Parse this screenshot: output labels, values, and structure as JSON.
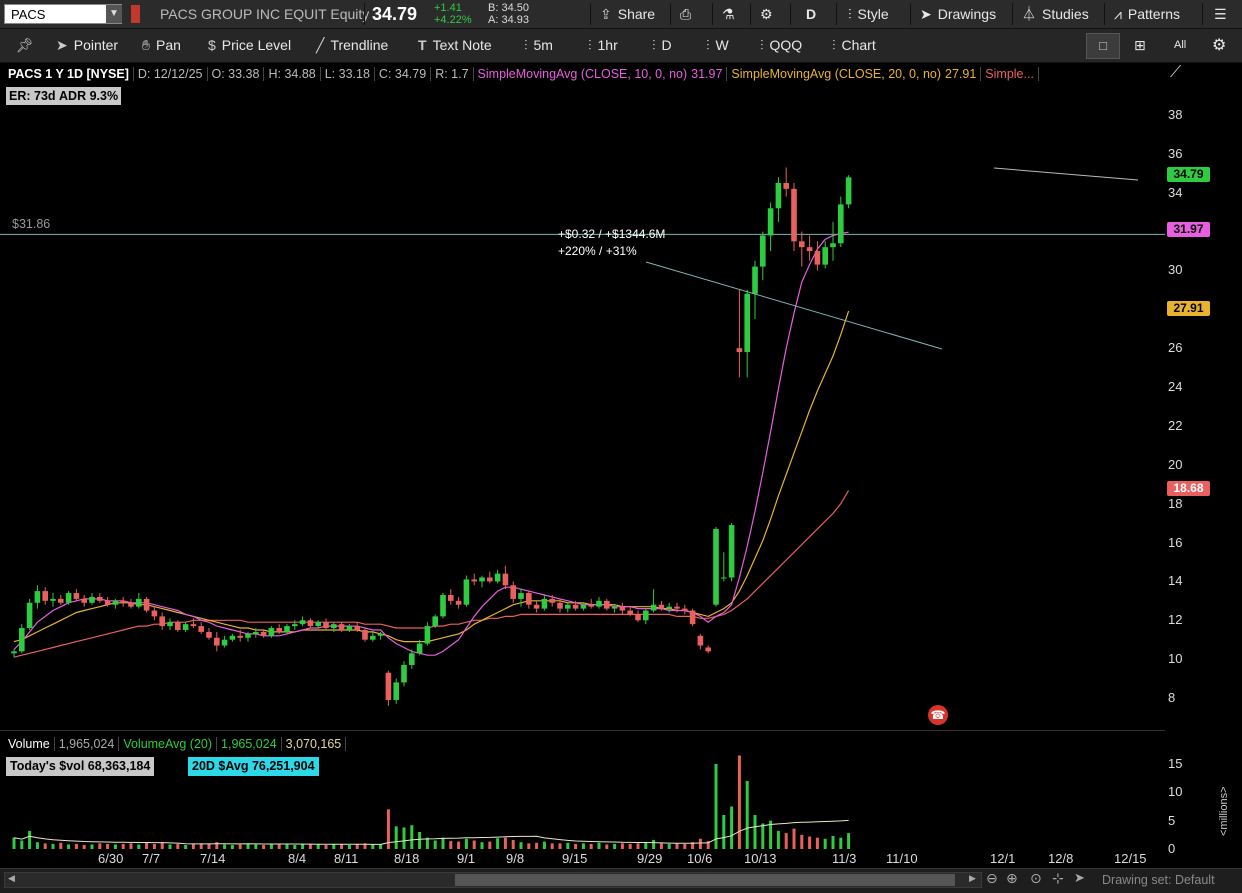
{
  "topbar": {
    "symbol": "PACS",
    "company": "PACS GROUP INC EQUIT Equity",
    "last": "34.79",
    "change": "+1.41",
    "change_pct": "+4.22%",
    "bid": "B: 34.50",
    "ask": "A: 34.93",
    "share": "Share",
    "period": "D",
    "style": "Style",
    "drawings": "Drawings",
    "studies": "Studies",
    "patterns": "Patterns"
  },
  "toolbar": {
    "pointer": "Pointer",
    "pan": "Pan",
    "price_level": "Price Level",
    "trendline": "Trendline",
    "text_note": "Text Note",
    "t5m": "5m",
    "t1hr": "1hr",
    "tD": "D",
    "tW": "W",
    "qqq": "QQQ",
    "chart": "Chart",
    "all": "All"
  },
  "info": {
    "title": "PACS 1 Y 1D [NYSE]",
    "date": "D: 12/12/25",
    "open": "O: 33.38",
    "high": "H: 34.88",
    "low": "L: 33.18",
    "close": "C: 34.79",
    "range": "R: 1.7",
    "sma10_label": "SimpleMovingAvg (CLOSE, 10, 0, no)",
    "sma10_val": "31.97",
    "sma20_label": "SimpleMovingAvg (CLOSE, 20, 0, no)",
    "sma20_val": "27.91",
    "sma_more": "Simple..."
  },
  "badges": {
    "er": "ER: 73d",
    "adr": "ADR 9.3%"
  },
  "level_line_label": "$31.86",
  "annotation": {
    "line1": "+$0.32 / +$1344.6M",
    "line2": "+220% / +31%"
  },
  "price_tags": {
    "last": "34.79",
    "sma10": "31.97",
    "sma20": "27.91",
    "sma50": "18.68"
  },
  "price_axis": [
    "38",
    "36",
    "34",
    "32",
    "30",
    "28",
    "26",
    "24",
    "22",
    "20",
    "18",
    "16",
    "14",
    "12",
    "10",
    "8"
  ],
  "volume": {
    "label": "Volume",
    "value": "1,965,024",
    "avg_label": "VolumeAvg (20)",
    "avg_value": "1,965,024",
    "other": "3,070,165",
    "todays": "Today's $vol 68,363,184",
    "avg20d": "20D $Avg 76,251,904",
    "axis": [
      "15",
      "10",
      "5",
      "0"
    ],
    "unit": "<millions>"
  },
  "x_axis": [
    "6/30",
    "7/7",
    "7/14",
    "8/4",
    "8/11",
    "8/18",
    "9/1",
    "9/8",
    "9/15",
    "9/29",
    "10/6",
    "10/13",
    "11/3",
    "11/10",
    "12/1",
    "12/8",
    "12/15"
  ],
  "bottom": {
    "drawing_set": "Drawing set: Default"
  },
  "colors": {
    "up": "#2ecc40",
    "down": "#e8615f",
    "sma10": "#e85ee0",
    "sma20": "#e8b430",
    "sma50": "#e8615f",
    "level": "#7fb5b5"
  },
  "chart_data": {
    "type": "candlestick",
    "candles": [
      [
        10.3,
        10.5,
        10.1,
        10.4
      ],
      [
        10.4,
        11.8,
        10.3,
        11.6
      ],
      [
        11.6,
        13.1,
        11.5,
        12.9
      ],
      [
        12.9,
        13.8,
        12.6,
        13.5
      ],
      [
        13.5,
        13.7,
        12.8,
        13.0
      ],
      [
        13.0,
        13.4,
        12.7,
        13.1
      ],
      [
        13.1,
        13.3,
        12.8,
        12.9
      ],
      [
        12.9,
        13.5,
        12.8,
        13.4
      ],
      [
        13.4,
        13.6,
        13.0,
        13.1
      ],
      [
        13.1,
        13.3,
        12.7,
        12.9
      ],
      [
        12.9,
        13.4,
        12.8,
        13.2
      ],
      [
        13.2,
        13.4,
        12.9,
        13.0
      ],
      [
        13.0,
        13.2,
        12.7,
        12.8
      ],
      [
        12.8,
        13.1,
        12.6,
        13.0
      ],
      [
        13.0,
        13.2,
        12.7,
        12.9
      ],
      [
        12.9,
        13.1,
        12.6,
        12.7
      ],
      [
        12.7,
        13.4,
        12.6,
        13.1
      ],
      [
        13.1,
        13.2,
        12.4,
        12.5
      ],
      [
        12.5,
        12.7,
        12.0,
        12.2
      ],
      [
        12.2,
        12.4,
        11.5,
        11.7
      ],
      [
        11.7,
        12.1,
        11.5,
        11.9
      ],
      [
        11.9,
        12.0,
        11.4,
        11.5
      ],
      [
        11.5,
        11.9,
        11.4,
        11.8
      ],
      [
        11.8,
        12.1,
        11.6,
        11.7
      ],
      [
        11.7,
        11.9,
        11.3,
        11.4
      ],
      [
        11.4,
        11.6,
        11.0,
        11.1
      ],
      [
        11.1,
        11.4,
        10.4,
        10.7
      ],
      [
        10.7,
        11.2,
        10.6,
        11.0
      ],
      [
        11.0,
        11.3,
        10.9,
        11.2
      ],
      [
        11.2,
        11.5,
        10.9,
        11.1
      ],
      [
        11.1,
        11.4,
        10.9,
        11.3
      ],
      [
        11.3,
        11.6,
        11.1,
        11.4
      ],
      [
        11.4,
        11.5,
        11.1,
        11.2
      ],
      [
        11.2,
        11.7,
        11.1,
        11.6
      ],
      [
        11.6,
        11.8,
        11.3,
        11.4
      ],
      [
        11.4,
        11.8,
        11.3,
        11.7
      ],
      [
        11.7,
        12.0,
        11.5,
        11.8
      ],
      [
        11.8,
        12.2,
        11.7,
        12.0
      ],
      [
        12.0,
        12.1,
        11.6,
        11.7
      ],
      [
        11.7,
        12.0,
        11.6,
        11.9
      ],
      [
        11.9,
        12.1,
        11.5,
        11.6
      ],
      [
        11.6,
        11.9,
        11.4,
        11.8
      ],
      [
        11.8,
        11.9,
        11.4,
        11.5
      ],
      [
        11.5,
        11.8,
        11.4,
        11.7
      ],
      [
        11.7,
        11.9,
        11.4,
        11.5
      ],
      [
        11.5,
        11.6,
        10.9,
        11.0
      ],
      [
        11.0,
        11.4,
        10.9,
        11.2
      ],
      [
        11.2,
        11.4,
        11.0,
        11.3
      ],
      [
        9.3,
        9.4,
        7.6,
        7.9
      ],
      [
        7.9,
        9.0,
        7.7,
        8.8
      ],
      [
        8.8,
        9.9,
        8.6,
        9.7
      ],
      [
        9.7,
        10.5,
        9.5,
        10.3
      ],
      [
        10.3,
        11.0,
        10.2,
        10.8
      ],
      [
        10.8,
        11.9,
        10.7,
        11.7
      ],
      [
        11.7,
        12.3,
        11.6,
        12.2
      ],
      [
        12.2,
        13.4,
        12.1,
        13.3
      ],
      [
        13.3,
        13.6,
        12.8,
        13.0
      ],
      [
        13.0,
        13.2,
        12.6,
        12.8
      ],
      [
        12.8,
        14.3,
        12.7,
        14.1
      ],
      [
        14.1,
        14.4,
        13.8,
        14.0
      ],
      [
        14.0,
        14.3,
        13.7,
        14.2
      ],
      [
        14.2,
        14.5,
        13.9,
        14.0
      ],
      [
        14.0,
        14.6,
        13.9,
        14.4
      ],
      [
        14.4,
        14.8,
        13.6,
        13.8
      ],
      [
        13.8,
        14.0,
        12.9,
        13.1
      ],
      [
        13.1,
        13.6,
        12.7,
        13.4
      ],
      [
        13.4,
        13.5,
        12.6,
        12.8
      ],
      [
        12.8,
        13.0,
        12.4,
        12.6
      ],
      [
        12.6,
        13.3,
        12.5,
        13.1
      ],
      [
        13.1,
        13.3,
        12.7,
        12.9
      ],
      [
        12.9,
        13.1,
        12.4,
        12.6
      ],
      [
        12.6,
        12.9,
        12.4,
        12.8
      ],
      [
        12.8,
        13.0,
        12.5,
        12.6
      ],
      [
        12.6,
        12.9,
        12.5,
        12.8
      ],
      [
        12.8,
        13.1,
        12.6,
        12.7
      ],
      [
        12.7,
        13.2,
        12.6,
        13.0
      ],
      [
        13.0,
        13.1,
        12.5,
        12.6
      ],
      [
        12.6,
        12.8,
        12.4,
        12.7
      ],
      [
        12.7,
        12.9,
        12.3,
        12.5
      ],
      [
        12.5,
        12.7,
        12.2,
        12.3
      ],
      [
        12.3,
        12.5,
        11.9,
        12.0
      ],
      [
        12.0,
        12.6,
        11.8,
        12.5
      ],
      [
        12.5,
        13.6,
        12.4,
        12.8
      ],
      [
        12.8,
        13.0,
        12.5,
        12.6
      ],
      [
        12.6,
        12.9,
        12.4,
        12.7
      ],
      [
        12.7,
        12.9,
        12.4,
        12.6
      ],
      [
        12.6,
        12.8,
        12.3,
        12.5
      ],
      [
        12.5,
        12.6,
        11.7,
        11.8
      ],
      [
        11.2,
        11.3,
        10.5,
        10.7
      ],
      [
        10.6,
        10.7,
        10.3,
        10.4
      ],
      [
        12.8,
        16.8,
        12.7,
        16.7
      ],
      [
        14.2,
        15.5,
        14.0,
        14.2
      ],
      [
        14.2,
        17.0,
        14.0,
        16.9
      ],
      [
        26.0,
        29.0,
        24.5,
        25.8
      ],
      [
        25.8,
        29.0,
        24.5,
        28.8
      ],
      [
        28.8,
        30.5,
        27.5,
        30.2
      ],
      [
        30.2,
        32.0,
        29.5,
        31.8
      ],
      [
        31.8,
        33.5,
        31.0,
        33.2
      ],
      [
        33.2,
        34.8,
        32.5,
        34.5
      ],
      [
        34.5,
        35.3,
        33.8,
        34.2
      ],
      [
        34.2,
        34.5,
        31.0,
        31.5
      ],
      [
        31.5,
        32.0,
        30.2,
        31.2
      ],
      [
        31.2,
        31.8,
        30.5,
        31.0
      ],
      [
        31.0,
        31.5,
        30.0,
        30.3
      ],
      [
        30.3,
        31.5,
        30.1,
        31.2
      ],
      [
        31.2,
        32.5,
        30.5,
        31.4
      ],
      [
        31.4,
        33.8,
        31.2,
        33.4
      ],
      [
        33.4,
        34.9,
        33.2,
        34.79
      ]
    ],
    "volume_millions": [
      2.0,
      1.5,
      3.2,
      1.2,
      1.0,
      0.9,
      1.1,
      0.8,
      0.9,
      0.7,
      0.8,
      1.0,
      0.9,
      0.8,
      0.9,
      1.0,
      0.8,
      1.1,
      0.9,
      1.2,
      0.8,
      0.9,
      0.7,
      0.9,
      1.0,
      0.9,
      1.2,
      0.8,
      0.7,
      0.8,
      0.9,
      0.8,
      0.7,
      0.8,
      0.9,
      0.8,
      0.7,
      0.9,
      0.8,
      0.9,
      0.7,
      0.9,
      0.8,
      0.7,
      0.8,
      1.0,
      0.8,
      0.8,
      7.0,
      4.0,
      3.8,
      4.2,
      3.0,
      2.0,
      1.5,
      2.0,
      1.4,
      1.3,
      1.8,
      1.5,
      1.2,
      1.3,
      1.9,
      2.0,
      1.6,
      1.2,
      1.0,
      1.1,
      1.3,
      1.0,
      1.0,
      1.1,
      0.9,
      1.0,
      0.9,
      1.1,
      0.8,
      0.9,
      1.0,
      0.9,
      1.0,
      1.1,
      1.6,
      1.0,
      0.9,
      1.0,
      0.9,
      1.2,
      1.8,
      1.4,
      15.0,
      6.0,
      7.5,
      16.5,
      12.0,
      6.0,
      4.5,
      5.0,
      3.2,
      2.8,
      3.6,
      2.5,
      2.2,
      2.0,
      1.8,
      2.3,
      2.0,
      2.8
    ],
    "sma10": [
      10.5,
      10.9,
      11.4,
      11.9,
      12.2,
      12.5,
      12.7,
      12.9,
      13.0,
      13.1,
      13.1,
      13.1,
      13.0,
      13.0,
      13.0,
      12.9,
      12.9,
      12.9,
      12.8,
      12.7,
      12.6,
      12.5,
      12.3,
      12.2,
      12.0,
      11.9,
      11.7,
      11.6,
      11.5,
      11.4,
      11.3,
      11.3,
      11.2,
      11.2,
      11.2,
      11.3,
      11.4,
      11.5,
      11.6,
      11.6,
      11.7,
      11.7,
      11.7,
      11.7,
      11.7,
      11.6,
      11.5,
      11.5,
      11.1,
      10.8,
      10.6,
      10.4,
      10.3,
      10.2,
      10.2,
      10.4,
      10.7,
      11.0,
      11.6,
      12.2,
      12.7,
      13.1,
      13.5,
      13.7,
      13.7,
      13.6,
      13.5,
      13.4,
      13.3,
      13.2,
      13.1,
      13.0,
      12.9,
      12.8,
      12.8,
      12.8,
      12.8,
      12.7,
      12.7,
      12.7,
      12.6,
      12.6,
      12.6,
      12.6,
      12.5,
      12.5,
      12.5,
      12.4,
      12.2,
      11.9,
      12.2,
      12.4,
      12.8,
      14.2,
      15.8,
      17.6,
      19.6,
      21.7,
      23.9,
      26.0,
      27.8,
      29.4,
      30.3,
      31.1,
      31.6,
      31.8,
      31.9,
      31.97
    ],
    "sma20": [
      10.9,
      11.0,
      11.2,
      11.4,
      11.6,
      11.8,
      12.0,
      12.2,
      12.4,
      12.5,
      12.6,
      12.7,
      12.8,
      12.9,
      12.9,
      12.9,
      12.8,
      12.8,
      12.7,
      12.6,
      12.5,
      12.4,
      12.3,
      12.2,
      12.1,
      12.0,
      11.9,
      11.8,
      11.7,
      11.6,
      11.6,
      11.5,
      11.5,
      11.4,
      11.4,
      11.4,
      11.4,
      11.5,
      11.5,
      11.5,
      11.5,
      11.5,
      11.5,
      11.5,
      11.5,
      11.4,
      11.4,
      11.3,
      11.2,
      11.0,
      10.9,
      10.9,
      10.9,
      10.9,
      11.0,
      11.1,
      11.2,
      11.3,
      11.5,
      11.8,
      12.0,
      12.2,
      12.4,
      12.6,
      12.8,
      12.9,
      13.0,
      13.0,
      13.0,
      13.0,
      13.0,
      12.9,
      12.9,
      12.9,
      12.8,
      12.8,
      12.8,
      12.8,
      12.7,
      12.7,
      12.7,
      12.7,
      12.7,
      12.6,
      12.6,
      12.5,
      12.5,
      12.4,
      12.3,
      12.2,
      12.4,
      12.6,
      12.9,
      13.5,
      14.3,
      15.2,
      16.1,
      17.2,
      18.4,
      19.5,
      20.6,
      21.7,
      22.8,
      23.8,
      24.7,
      25.6,
      26.7,
      27.91
    ],
    "sma50": [
      10.1,
      10.2,
      10.3,
      10.4,
      10.5,
      10.6,
      10.7,
      10.8,
      10.9,
      11.0,
      11.1,
      11.2,
      11.3,
      11.4,
      11.5,
      11.6,
      11.7,
      11.7,
      11.8,
      11.8,
      11.9,
      11.9,
      11.9,
      12.0,
      12.0,
      12.0,
      12.0,
      12.0,
      12.0,
      12.0,
      11.9,
      11.9,
      11.9,
      11.9,
      11.9,
      11.9,
      11.9,
      11.9,
      11.9,
      11.9,
      11.9,
      11.9,
      11.9,
      11.9,
      11.9,
      11.8,
      11.8,
      11.8,
      11.7,
      11.6,
      11.6,
      11.6,
      11.6,
      11.6,
      11.7,
      11.7,
      11.8,
      11.8,
      11.9,
      12.0,
      12.0,
      12.1,
      12.1,
      12.2,
      12.2,
      12.3,
      12.3,
      12.3,
      12.3,
      12.3,
      12.3,
      12.3,
      12.3,
      12.3,
      12.3,
      12.3,
      12.3,
      12.3,
      12.3,
      12.3,
      12.3,
      12.3,
      12.3,
      12.3,
      12.3,
      12.2,
      12.2,
      12.2,
      12.1,
      12.1,
      12.2,
      12.3,
      12.5,
      12.8,
      13.1,
      13.5,
      13.9,
      14.3,
      14.7,
      15.1,
      15.5,
      15.9,
      16.3,
      16.7,
      17.1,
      17.5,
      18.0,
      18.68
    ],
    "price_range": [
      7,
      39.5
    ],
    "volume_range": [
      0,
      17
    ],
    "level_price": 31.86
  }
}
